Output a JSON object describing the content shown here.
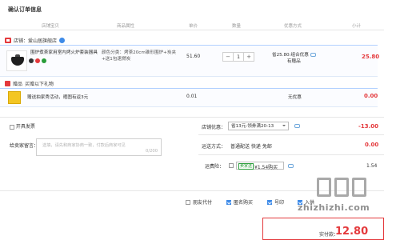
{
  "page_title": "确认订单信息",
  "columns": [
    "店铺宝贝",
    "商品属性",
    "单价",
    "数量",
    "优惠方式",
    "小计"
  ],
  "store": {
    "name": "店铺：爱山居旗舰店"
  },
  "item": {
    "name": "围炉煮茶家用室内烤火炉套装器具 ...",
    "spec": "颜色分类：烤茶20cm锥形围炉+炭夹+送1包速燃炭",
    "price": "51.60",
    "quantity": "1",
    "promo_line1": "省25.80:组合优惠",
    "promo_line2": "有赠品",
    "subtotal": "25.80"
  },
  "gift": {
    "header": "赠品",
    "header_detail": "买赠以下礼物",
    "name": "赠送拍家秀活动，晒图有返3元",
    "price": "0.01",
    "promo": "无优惠",
    "subtotal": "0.00"
  },
  "invoice": {
    "label": "开具发票"
  },
  "message": {
    "label": "给卖家留言：",
    "placeholder": "选填，请先和商家协商一致，付款后商家可见",
    "count": "0/200"
  },
  "store_discount": {
    "label": "店铺优惠：",
    "value": "省13元:领券满20-13",
    "amount": "-13.00"
  },
  "shipping": {
    "label": "运送方式：",
    "value": "普通配送 快递 免邮",
    "amount": "0.00"
  },
  "insurance": {
    "label": "运费险：",
    "tag": "卖家送",
    "value": "¥1.54购买",
    "amount": "1.54"
  },
  "options": {
    "anonymous": "匿名购买",
    "friend_pay": "朋友代付",
    "other": "号印",
    "confirm_note": "入供"
  },
  "payment": {
    "label": "实付款：",
    "amount": "12.80"
  },
  "watermark": {
    "text": "zhizhizhi.com"
  }
}
